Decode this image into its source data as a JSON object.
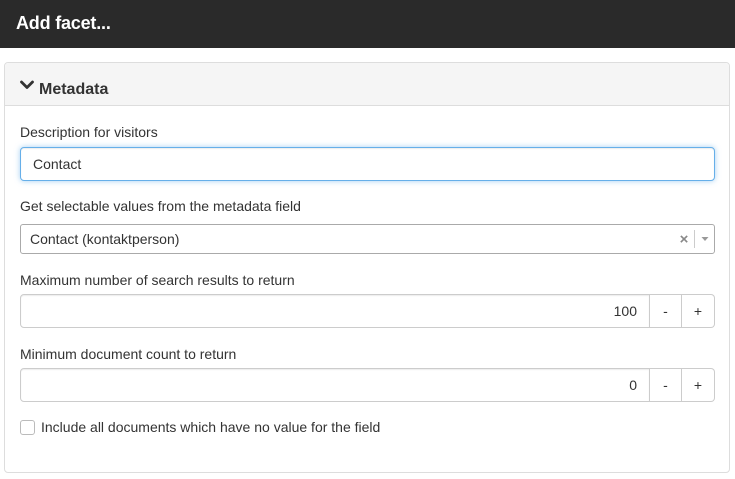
{
  "dialog": {
    "title": "Add facet..."
  },
  "panel": {
    "title": "Metadata",
    "icon": "chevron-down-icon"
  },
  "description": {
    "label": "Description for visitors",
    "value": "Contact"
  },
  "metadata_field": {
    "label": "Get selectable values from the metadata field",
    "selected": "Contact (kontaktperson)",
    "clear_glyph": "×"
  },
  "max_results": {
    "label": "Maximum number of search results to return",
    "value": "100",
    "decrement_label": "-",
    "increment_label": "+"
  },
  "min_doc_count": {
    "label": "Minimum document count to return",
    "value": "0",
    "decrement_label": "-",
    "increment_label": "+"
  },
  "include_empty": {
    "label": "Include all documents which have no value for the field",
    "checked": false
  },
  "colors": {
    "header_bg": "#2a2a2a",
    "focus_border": "#66afe9",
    "panel_heading_bg": "#f5f5f5"
  }
}
